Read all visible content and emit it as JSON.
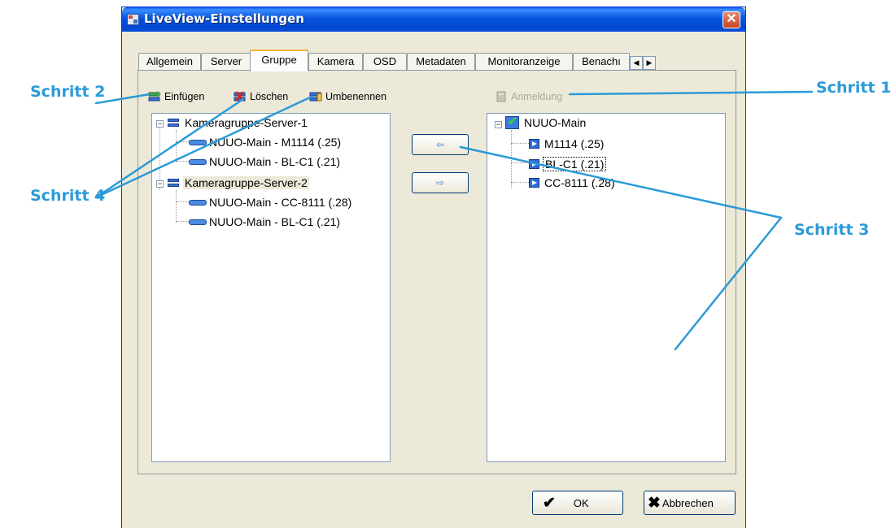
{
  "window": {
    "title": "LiveView-Einstellungen",
    "close_glyph": "✕"
  },
  "tabs": [
    {
      "label": "Allgemein"
    },
    {
      "label": "Server"
    },
    {
      "label": "Gruppe",
      "active": true
    },
    {
      "label": "Kamera"
    },
    {
      "label": "OSD"
    },
    {
      "label": "Metadaten"
    },
    {
      "label": "Monitoranzeige"
    },
    {
      "label": "Benachı"
    }
  ],
  "tab_scroll": {
    "left": "◀",
    "right": "▶"
  },
  "left_toolbar": {
    "insert": "Einfügen",
    "delete": "Löschen",
    "rename": "Umbenennen"
  },
  "right_toolbar": {
    "login": "Anmeldung"
  },
  "left_tree": {
    "groups": [
      {
        "label": "Kameragruppe-Server-1",
        "cameras": [
          "NUUO-Main - M1114 (.25)",
          "NUUO-Main - BL-C1 (.21)"
        ]
      },
      {
        "label": "Kameragruppe-Server-2",
        "cameras": [
          "NUUO-Main - CC-8111 (.28)",
          "NUUO-Main - BL-C1 (.21)"
        ]
      }
    ]
  },
  "right_tree": {
    "root": "NUUO-Main",
    "cameras": [
      "M1114 (.25)",
      "BL-C1 (.21)",
      "CC-8111 (.28)"
    ]
  },
  "arrows": {
    "add": "⇦",
    "remove": "⇨"
  },
  "buttons": {
    "ok": "OK",
    "ok_mark": "✔",
    "cancel": "Abbrechen",
    "cancel_mark": "✖"
  },
  "callouts": {
    "step1": "Schritt 1",
    "step2": "Schritt 2",
    "step3": "Schritt 3",
    "step4": "Schritt 4"
  },
  "colors": {
    "callout": "#2b9ad8",
    "titlebar": "#0054e3",
    "dialog_bg": "#ece9d8"
  }
}
